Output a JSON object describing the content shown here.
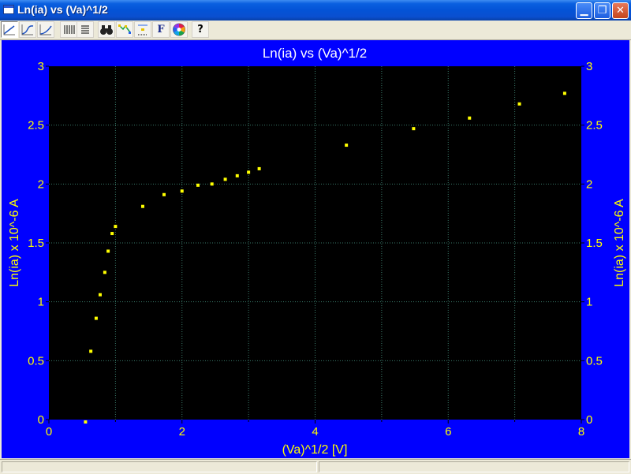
{
  "window": {
    "title": "Ln(ia) vs (Va)^1/2",
    "buttons": [
      "minimize",
      "restore",
      "close"
    ]
  },
  "toolbar": {
    "items": [
      {
        "name": "line-chart-1",
        "icon": "line-chart-icon"
      },
      {
        "name": "line-chart-2",
        "icon": "curve-chart-icon"
      },
      {
        "name": "line-chart-3",
        "icon": "smooth-chart-icon"
      },
      {
        "name": "vertical-grid",
        "icon": "vertical-grid-icon"
      },
      {
        "name": "horizontal-grid",
        "icon": "horizontal-grid-icon"
      },
      {
        "name": "zoom",
        "icon": "binoculars-icon"
      },
      {
        "name": "markers",
        "icon": "markers-icon"
      },
      {
        "name": "legend",
        "icon": "legend-icon"
      },
      {
        "name": "font",
        "icon": "font-icon",
        "label": "F"
      },
      {
        "name": "color",
        "icon": "color-wheel-icon"
      },
      {
        "name": "help",
        "icon": "help-icon",
        "label": "?"
      }
    ]
  },
  "chart_data": {
    "type": "scatter",
    "title": "Ln(ia) vs (Va)^1/2",
    "xlabel": "(Va)^1/2 [V]",
    "ylabel": "Ln(ia) x 10^-6 A",
    "y2label": "Ln(ia) x 10^-6 A",
    "xlim": [
      0,
      8
    ],
    "ylim": [
      0,
      3
    ],
    "xticks": [
      0,
      2,
      4,
      6,
      8
    ],
    "xtick_labels": [
      "0",
      "2",
      "4",
      "6",
      "8"
    ],
    "xgrid": [
      0,
      1,
      2,
      3,
      4,
      5,
      6,
      7,
      8
    ],
    "yticks": [
      0,
      0.5,
      1,
      1.5,
      2,
      2.5,
      3
    ],
    "ytick_labels": [
      "0",
      "0.5",
      "1",
      "1.5",
      "2",
      "2.5",
      "3"
    ],
    "grid": true,
    "colors": {
      "background": "#0000ff",
      "plot": "#000000",
      "marker": "#ffff00",
      "text": "#ffff00",
      "title": "#ffffff",
      "grid": "#3a7a6a"
    },
    "series": [
      {
        "x": [
          0.55,
          0.63,
          0.71,
          0.77,
          0.84,
          0.89,
          0.95,
          1.0,
          1.41,
          1.73,
          2.0,
          2.24,
          2.45,
          2.65,
          2.83,
          3.0,
          3.16,
          4.47,
          5.48,
          6.32,
          7.07,
          7.75
        ],
        "y": [
          -0.02,
          0.58,
          0.86,
          1.06,
          1.25,
          1.43,
          1.58,
          1.64,
          1.81,
          1.91,
          1.94,
          1.99,
          2.0,
          2.04,
          2.07,
          2.1,
          2.13,
          2.33,
          2.47,
          2.56,
          2.68,
          2.77
        ]
      }
    ]
  }
}
